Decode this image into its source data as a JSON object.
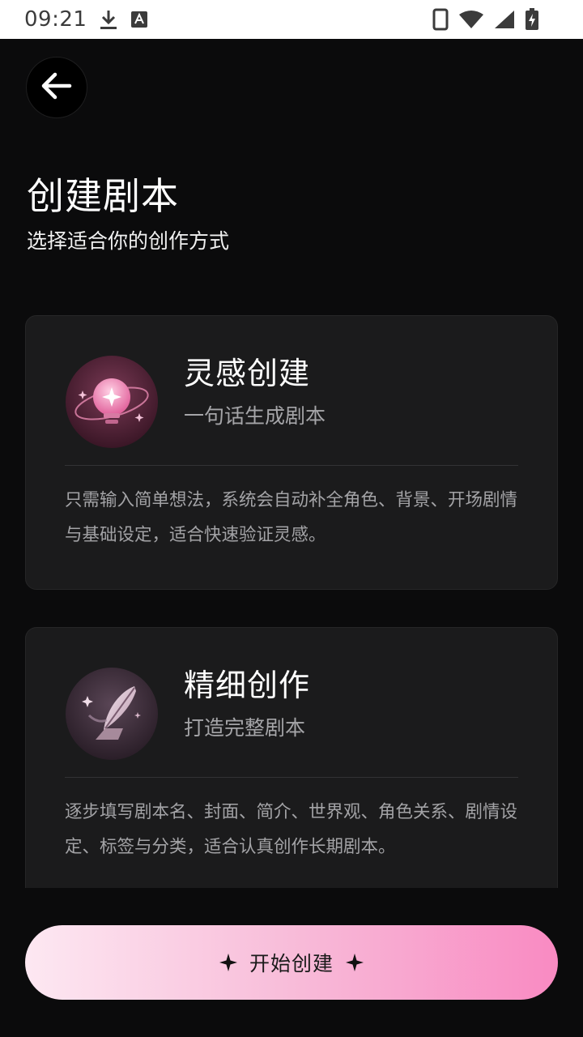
{
  "status_bar": {
    "time": "09:21",
    "icons": [
      "download-icon",
      "keyboard-a-icon",
      "phone-outline-icon",
      "wifi-icon",
      "signal-icon",
      "battery-charging-icon"
    ]
  },
  "header": {
    "back_icon": "arrow-left-icon",
    "title": "创建剧本",
    "subtitle": "选择适合你的创作方式"
  },
  "options": [
    {
      "icon": "lightbulb-sparkle-icon",
      "title": "灵感创建",
      "subtitle": "一句话生成剧本",
      "description": "只需输入简单想法，系统会自动补全角色、背景、开场剧情与基础设定，适合快速验证灵感。"
    },
    {
      "icon": "quill-pen-icon",
      "title": "精细创作",
      "subtitle": "打造完整剧本",
      "description": "逐步填写剧本名、封面、简介、世界观、角色关系、剧情设定、标签与分类，适合认真创作长期剧本。"
    }
  ],
  "footer": {
    "start_label": "开始创建",
    "sparkle_icon": "four-point-star-icon"
  },
  "colors": {
    "background": "#0b0b0c",
    "card": "#1b1b1c",
    "accent_start": "#fde8f2",
    "accent_end": "#f98ac2"
  }
}
